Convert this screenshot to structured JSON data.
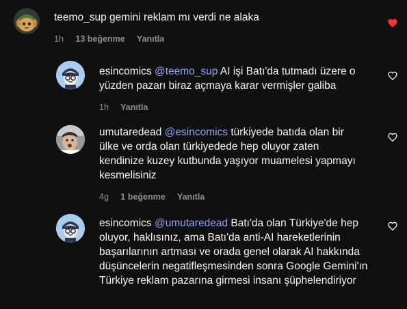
{
  "comments": [
    {
      "username": "teemo_sup",
      "mention": "",
      "text": "gemini reklam mı verdi ne alaka",
      "time": "1h",
      "likes": "13 beğenme",
      "reply": "Yanıtla",
      "liked": true,
      "heart_color": "#ff3040"
    },
    {
      "username": "esincomics",
      "mention": "@teemo_sup",
      "text": "AI işi Batı'da tutmadı üzere o yüzden pazarı biraz açmaya karar vermişler galiba",
      "time": "1h",
      "likes": "",
      "reply": "Yanıtla",
      "liked": false
    },
    {
      "username": "umutaredead",
      "mention": "@esincomics",
      "text": "türkiyede batıda olan bir ülke ve orda olan türkiyedede hep oluyor zaten kendinize kuzey kutbunda yaşıyor muamelesi yapmayı kesmelisiniz",
      "time": "4g",
      "likes": "1 beğenme",
      "reply": "Yanıtla",
      "liked": false
    },
    {
      "username": "esincomics",
      "mention": "@umutaredead",
      "text": "Batı'da olan Türkiye'de hep oluyor, haklısınız, ama Batı'da anti-AI hareketlerinin başarılarının artması ve orada genel olarak AI hakkında düşüncelerin negatifleşmesinden sonra Google Gemini'ın Türkiye reklam pazarına girmesi insanı şüphelendiriyor",
      "time": "",
      "likes": "",
      "reply": "",
      "liked": false
    }
  ],
  "colors": {
    "background": "#101010",
    "mention": "#8fa3f5",
    "meta": "#8e8e8e",
    "heart_liked": "#ff3040"
  },
  "icons": [
    "heart-icon",
    "avatar"
  ]
}
